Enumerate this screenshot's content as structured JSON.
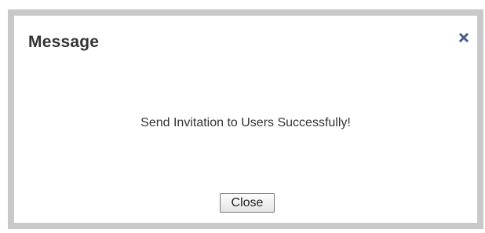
{
  "dialog": {
    "title": "Message",
    "message": "Send Invitation to Users Successfully!",
    "close_button_label": "Close",
    "close_icon": "close-x-icon"
  },
  "colors": {
    "frame": "#c9c9c9",
    "text": "#333333",
    "close_icon": "#4a5f8a"
  }
}
